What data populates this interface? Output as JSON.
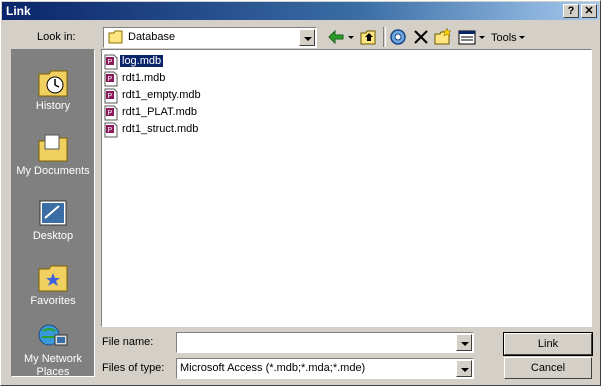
{
  "window": {
    "title": "Link",
    "help_label": "?",
    "close_label": "✕"
  },
  "toolbar": {
    "look_in_label": "Look in:",
    "look_in_value": "Database",
    "tools_label": "Tools"
  },
  "places": [
    {
      "label": "History"
    },
    {
      "label": "My Documents"
    },
    {
      "label": "Desktop"
    },
    {
      "label": "Favorites"
    },
    {
      "label": "My Network Places"
    }
  ],
  "files": [
    {
      "name": "log.mdb",
      "selected": true
    },
    {
      "name": "rdt1.mdb",
      "selected": false
    },
    {
      "name": "rdt1_empty.mdb",
      "selected": false
    },
    {
      "name": "rdt1_PLAT.mdb",
      "selected": false
    },
    {
      "name": "rdt1_struct.mdb",
      "selected": false
    }
  ],
  "footer": {
    "file_name_label": "File name:",
    "file_name_value": "",
    "files_of_type_label": "Files of type:",
    "files_of_type_value": "Microsoft Access (*.mdb;*.mda;*.mde)",
    "link_label": "Link",
    "cancel_label": "Cancel"
  },
  "colors": {
    "titlebar": "#0a246a",
    "selection": "#0a246a",
    "face": "#d4d0c8",
    "places_bg": "#808080"
  }
}
